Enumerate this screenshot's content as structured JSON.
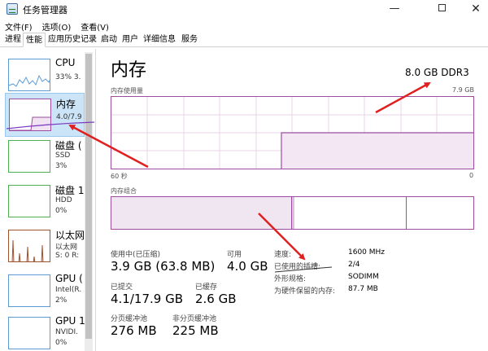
{
  "window": {
    "title": "任务管理器",
    "min": "—",
    "close": "✕"
  },
  "menu": [
    "文件(F)",
    "选项(O)",
    "查看(V)"
  ],
  "tabs": [
    "进程",
    "性能",
    "应用历史记录",
    "启动",
    "用户",
    "详细信息",
    "服务"
  ],
  "active_tab": 1,
  "sidebar": [
    {
      "name": "CPU",
      "sub1": "33% 3.",
      "sub2": ""
    },
    {
      "name": "内存",
      "sub1": "4.0/7.9",
      "sub2": ""
    },
    {
      "name": "磁盘 (",
      "sub1": "SSD",
      "sub2": "3%"
    },
    {
      "name": "磁盘 1",
      "sub1": "HDD",
      "sub2": "0%"
    },
    {
      "name": "以太网",
      "sub1": "以太网",
      "sub2": "S: 0 R:"
    },
    {
      "name": "GPU (",
      "sub1": "Intel(R.",
      "sub2": "2%"
    },
    {
      "name": "GPU 1",
      "sub1": "NVIDI.",
      "sub2": "0%"
    }
  ],
  "main": {
    "title": "内存",
    "spec": "8.0 GB DDR3",
    "usage_label": "内存使用量",
    "usage_max": "7.9 GB",
    "axis_left": "60 秒",
    "axis_right": "0",
    "composition_label": "内存组合",
    "stats": {
      "in_use_label": "使用中(已压缩)",
      "in_use_value": "3.9 GB (63.8 MB)",
      "available_label": "可用",
      "available_value": "4.0 GB",
      "committed_label": "已提交",
      "committed_value": "4.1/17.9 GB",
      "cached_label": "已缓存",
      "cached_value": "2.6 GB",
      "paged_label": "分页缓冲池",
      "paged_value": "276 MB",
      "nonpaged_label": "非分页缓冲池",
      "nonpaged_value": "225 MB"
    },
    "details": {
      "speed_label": "速度:",
      "speed_value": "1600 MHz",
      "slots_label": "已使用的插槽:",
      "slots_value": "2/4",
      "form_label": "外形规格:",
      "form_value": "SODIMM",
      "reserved_label": "为硬件保留的内存:",
      "reserved_value": "87.7 MB"
    }
  },
  "colors": {
    "memory": "#9c4da0",
    "accent": "#cce4f7",
    "annotation": "#e02020",
    "cpu": "#5b9bd5"
  }
}
